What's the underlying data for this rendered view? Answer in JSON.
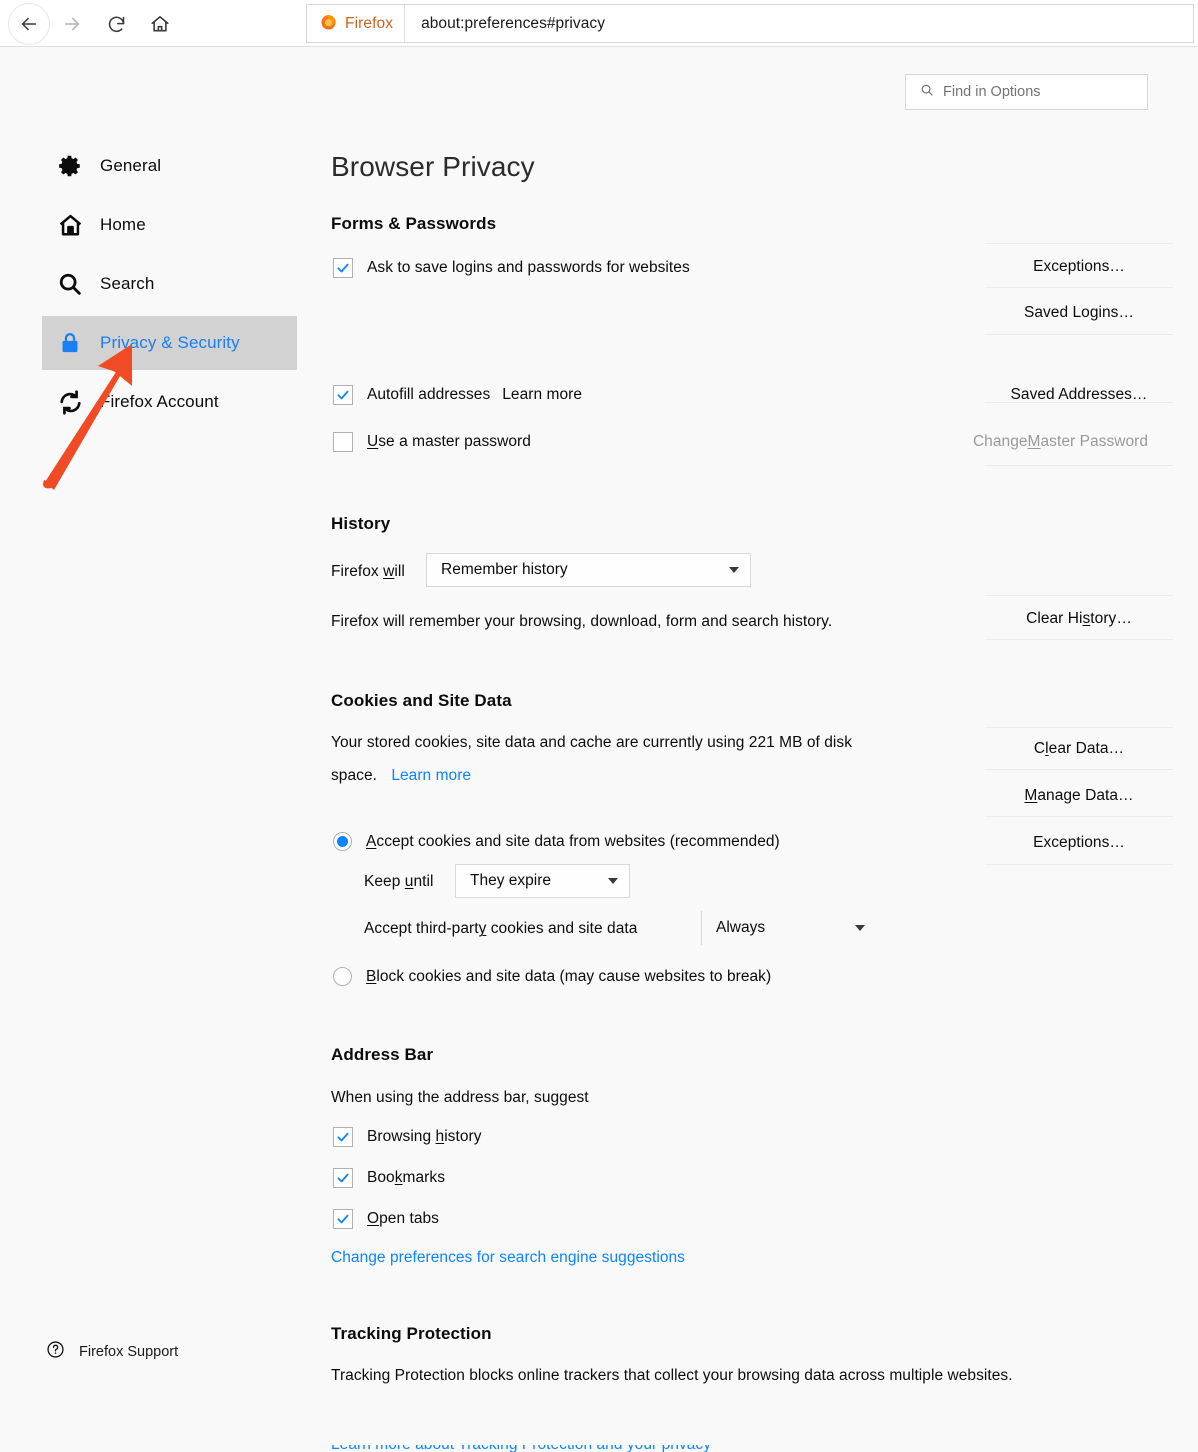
{
  "browser": {
    "back_icon": "back-arrow-icon",
    "forward_icon": "forward-arrow-icon",
    "reload_icon": "reload-icon",
    "home_icon": "home-icon",
    "brand_label": "Firefox",
    "url": "about:preferences#privacy"
  },
  "search": {
    "icon": "search-icon",
    "placeholder": "Find in Options"
  },
  "sidebar": {
    "items": [
      {
        "label": "General",
        "icon": "gear-icon",
        "active": false
      },
      {
        "label": "Home",
        "icon": "home-icon",
        "active": false
      },
      {
        "label": "Search",
        "icon": "search-icon",
        "active": false
      },
      {
        "label": "Privacy & Security",
        "icon": "lock-icon",
        "active": true
      },
      {
        "label": "Firefox Account",
        "icon": "sync-icon",
        "active": false
      }
    ],
    "support": {
      "label": "Firefox Support",
      "icon": "help-circle-icon"
    }
  },
  "main": {
    "title": "Browser Privacy",
    "forms": {
      "heading": "Forms & Passwords",
      "ask_to_save": "Ask to save logins and passwords for websites",
      "ask_to_save_checked": true,
      "autofill": "Autofill addresses",
      "autofill_checked": true,
      "autofill_learn_more": "Learn more",
      "master_password": "Use a master password",
      "master_password_checked": false,
      "buttons": {
        "exceptions": "Exceptions…",
        "saved_logins": "Saved Logins…",
        "saved_addresses": "Saved Addresses…",
        "change_master_password": "Change Master Password"
      }
    },
    "history": {
      "heading": "History",
      "prefix_label": "Firefox will",
      "mode_value": "Remember history",
      "description": "Firefox will remember your browsing, download, form and search history.",
      "clear_history_button": "Clear History…"
    },
    "cookies": {
      "heading": "Cookies and Site Data",
      "usage_line1": "Your stored cookies, site data and cache are currently using 221 MB of disk",
      "usage_line2": "space.",
      "usage_learn_more": "Learn more",
      "disk_usage": "221 MB",
      "accept_option": "Accept cookies and site data from websites (recommended)",
      "accept_selected": true,
      "keep_until_label": "Keep until",
      "keep_until_value": "They expire",
      "third_party_label": "Accept third-party cookies and site data",
      "third_party_value": "Always",
      "block_option": "Block cookies and site data (may cause websites to break)",
      "block_selected": false,
      "buttons": {
        "clear_data": "Clear Data…",
        "manage_data": "Manage Data…",
        "exceptions": "Exceptions…"
      }
    },
    "address_bar": {
      "heading": "Address Bar",
      "description": "When using the address bar, suggest",
      "options": [
        {
          "label": "Browsing history",
          "checked": true
        },
        {
          "label": "Bookmarks",
          "checked": true
        },
        {
          "label": "Open tabs",
          "checked": true
        }
      ],
      "change_prefs_link": "Change preferences for search engine suggestions"
    },
    "tracking": {
      "heading": "Tracking Protection",
      "description": "Tracking Protection blocks online trackers that collect your browsing data across multiple websites."
    }
  },
  "annotation": {
    "arrow_color": "#f04b25",
    "name": "red-arrow-pointing-to-privacy-security"
  },
  "colors": {
    "accent_blue": "#0a84ff",
    "link_blue": "#0a84ff",
    "active_sidebar_bg": "#d2d2d2",
    "page_bg": "#f9f9f9",
    "brand_orange": "#c8641b"
  }
}
